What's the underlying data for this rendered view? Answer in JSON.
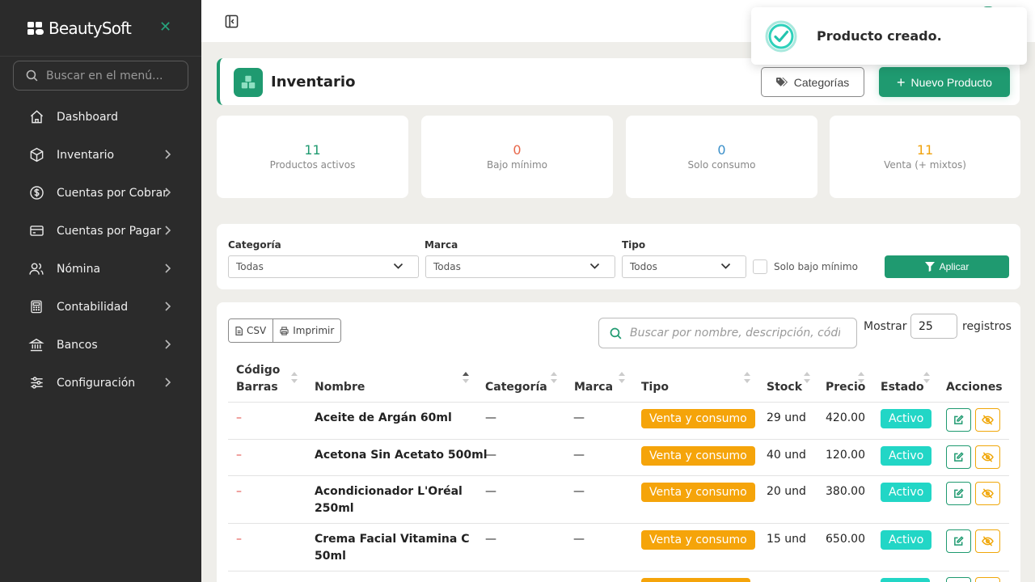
{
  "brand": {
    "name": "BeautySoft"
  },
  "sidebar": {
    "search_placeholder": "Buscar en el menú...",
    "items": [
      {
        "label": "Dashboard",
        "icon": "home-icon",
        "has_chevron": false
      },
      {
        "label": "Inventario",
        "icon": "box-icon",
        "has_chevron": true
      },
      {
        "label": "Cuentas por Cobrar",
        "icon": "dollar-circle-icon",
        "has_chevron": true
      },
      {
        "label": "Cuentas por Pagar",
        "icon": "credit-card-icon",
        "has_chevron": true
      },
      {
        "label": "Nómina",
        "icon": "users-icon",
        "has_chevron": true
      },
      {
        "label": "Contabilidad",
        "icon": "calculator-icon",
        "has_chevron": true
      },
      {
        "label": "Bancos",
        "icon": "bank-icon",
        "has_chevron": true
      },
      {
        "label": "Configuración",
        "icon": "sliders-icon",
        "has_chevron": true
      }
    ]
  },
  "toast": {
    "message": "Producto creado."
  },
  "header": {
    "title": "Inventario",
    "categories_button": "Categorías",
    "new_product_button": "Nuevo Producto"
  },
  "stats": [
    {
      "value": "11",
      "label": "Productos activos",
      "color": "#1f9a70"
    },
    {
      "value": "0",
      "label": "Bajo mínimo",
      "color": "#e8674a"
    },
    {
      "value": "0",
      "label": "Solo consumo",
      "color": "#3a8fc9"
    },
    {
      "value": "11",
      "label": "Venta (+ mixtos)",
      "color": "#f0a20c"
    }
  ],
  "filters": {
    "categoria": {
      "label": "Categoría",
      "value": "Todas"
    },
    "marca": {
      "label": "Marca",
      "value": "Todas"
    },
    "tipo": {
      "label": "Tipo",
      "value": "Todos"
    },
    "bajo_minimo_label": "Solo bajo mínimo",
    "apply_button": "Aplicar"
  },
  "table": {
    "csv_button": "CSV",
    "print_button": "Imprimir",
    "search_placeholder": "Buscar por nombre, descripción, código...",
    "show_label": "Mostrar",
    "page_size": "25",
    "records_label": "registros",
    "columns": {
      "codigo_line1": "Código",
      "codigo_line2": "Barras",
      "nombre": "Nombre",
      "categoria": "Categoría",
      "marca": "Marca",
      "tipo": "Tipo",
      "stock": "Stock",
      "precio": "Precio",
      "estado": "Estado",
      "acciones": "Acciones"
    },
    "rows": [
      {
        "codigo": "–",
        "nombre_l1": "Aceite de Argán 60ml",
        "nombre_l2": "",
        "categoria": "—",
        "marca": "—",
        "tipo": "Venta y consumo",
        "stock": "29 und",
        "precio": "420.00",
        "estado": "Activo"
      },
      {
        "codigo": "–",
        "nombre_l1": "Acetona Sin Acetato 500ml",
        "nombre_l2": "",
        "categoria": "—",
        "marca": "—",
        "tipo": "Venta y consumo",
        "stock": "40 und",
        "precio": "120.00",
        "estado": "Activo"
      },
      {
        "codigo": "–",
        "nombre_l1": "Acondicionador L'Oréal",
        "nombre_l2": "250ml",
        "categoria": "—",
        "marca": "—",
        "tipo": "Venta y consumo",
        "stock": "20 und",
        "precio": "380.00",
        "estado": "Activo"
      },
      {
        "codigo": "–",
        "nombre_l1": "Crema Facial Vitamina C",
        "nombre_l2": "50ml",
        "categoria": "—",
        "marca": "—",
        "tipo": "Venta y consumo",
        "stock": "15 und",
        "precio": "650.00",
        "estado": "Activo"
      },
      {
        "codigo": "",
        "nombre_l1": "",
        "nombre_l2": "",
        "categoria": "",
        "marca": "",
        "tipo": "",
        "stock": "",
        "precio": "",
        "estado": ""
      }
    ]
  },
  "colors": {
    "accent": "#1f9a70",
    "sidebar_bg": "#2b2b2b",
    "badge_tipo": "#f5a40a",
    "badge_estado": "#22d6c6",
    "danger": "#e0443f"
  }
}
